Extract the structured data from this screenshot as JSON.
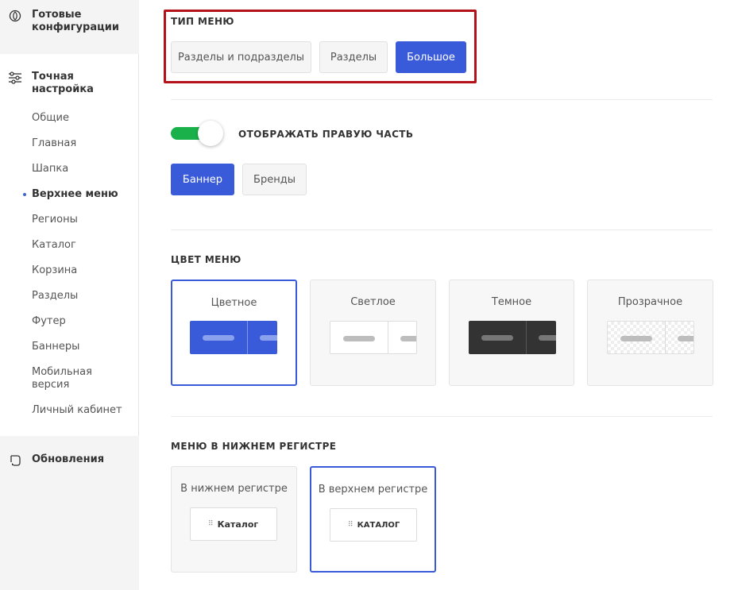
{
  "sidebar": {
    "ready_configs": "Готовые конфигурации",
    "fine_tuning": "Точная настройка",
    "items": [
      {
        "label": "Общие"
      },
      {
        "label": "Главная"
      },
      {
        "label": "Шапка"
      },
      {
        "label": "Верхнее меню"
      },
      {
        "label": "Регионы"
      },
      {
        "label": "Каталог"
      },
      {
        "label": "Корзина"
      },
      {
        "label": "Разделы"
      },
      {
        "label": "Футер"
      },
      {
        "label": "Баннеры"
      },
      {
        "label": "Мобильная версия"
      },
      {
        "label": "Личный кабинет"
      }
    ],
    "active_index": 3,
    "updates": "Обновления"
  },
  "menu_type": {
    "title": "ТИП МЕНЮ",
    "options": [
      "Разделы и подразделы",
      "Разделы",
      "Большое"
    ],
    "selected": "Большое"
  },
  "right_part": {
    "toggle_on": true,
    "title": "ОТОБРАЖАТЬ ПРАВУЮ ЧАСТЬ",
    "options": [
      "Баннер",
      "Бренды"
    ],
    "selected": "Баннер"
  },
  "menu_color": {
    "title": "ЦВЕТ МЕНЮ",
    "options": [
      {
        "label": "Цветное"
      },
      {
        "label": "Светлое"
      },
      {
        "label": "Темное"
      },
      {
        "label": "Прозрачное"
      }
    ],
    "selected": "Цветное"
  },
  "menu_case": {
    "title": "МЕНЮ В НИЖНЕМ РЕГИСТРЕ",
    "options": [
      {
        "label": "В нижнем регистре",
        "sample": "Каталог"
      },
      {
        "label": "В верхнем регистре",
        "sample": "КАТАЛОГ"
      }
    ],
    "selected": "В верхнем регистре"
  },
  "colors": {
    "accent": "#3a5bd9",
    "toggle_on": "#1bb14a",
    "highlight_frame": "#b3121b",
    "dark_menu": "#333333"
  }
}
